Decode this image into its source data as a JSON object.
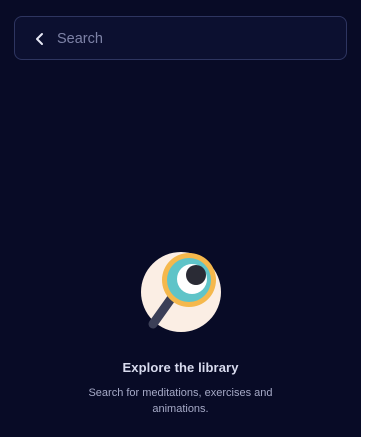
{
  "search": {
    "placeholder": "Search",
    "value": ""
  },
  "icons": {
    "back": "chevron-left-icon",
    "illustration": "magnifying-glass-icon"
  },
  "empty_state": {
    "title": "Explore the library",
    "subtitle": "Search for meditations, exercises and animations."
  },
  "colors": {
    "background": "#080b26",
    "search_border": "#2e3560",
    "circle_bg": "#fbeee4",
    "lens_rim": "#f5b84c",
    "lens_inner": "#5fc4c8",
    "handle": "#3b3f57"
  }
}
